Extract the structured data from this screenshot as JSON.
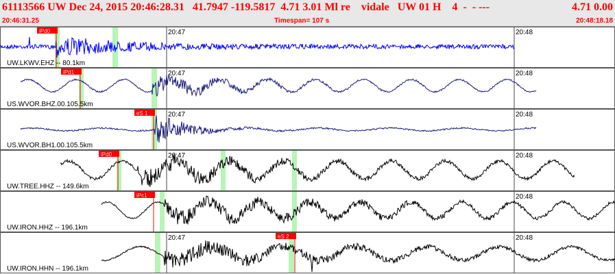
{
  "header": {
    "title": "61113566 UW Dec 24, 2015 20:46:28.31   41.7947 -119.5817  4.71 3.01 Ml re    vidale   UW 01 H    4  -  - ---",
    "title_right": "4.71 0.00",
    "start_time": "20:46:31.25",
    "timespan": "Timespan= 107 s",
    "end_time": "20:48:18.18"
  },
  "colors": {
    "title_text": "#ff0000",
    "bar_bg": "#e8e8e8",
    "pick_box": "#ff0000",
    "pick_highlight": "#b6f5b6",
    "trace_blue": "#0000ff",
    "trace_navy": "#1a1a7a",
    "trace_black": "#000000"
  },
  "panels": [
    {
      "label": "UW.LKWV.EHZ -- 80.1km",
      "minute_labels": [
        "20:47",
        "20:48"
      ],
      "pick": "iPd0",
      "trace_color": "#0000ff"
    },
    {
      "label": "US.WVOR.BHZ.00.105.5km",
      "minute_labels": [
        "20:47",
        "20:48"
      ],
      "pick": "iPd1",
      "trace_color": "#1a1a7a"
    },
    {
      "label": "US.WVOR.BH1.00.105.5km",
      "minute_labels": [
        "20:47",
        "20:48"
      ],
      "pick": "eS 1",
      "trace_color": "#1a1a7a"
    },
    {
      "label": "UW.TREE.HHZ -- 149.6km",
      "minute_labels": [
        "20:47",
        "20:48"
      ],
      "pick": "iPd0",
      "trace_color": "#000000"
    },
    {
      "label": "UW.IRON.HHZ -- 196.1km",
      "minute_labels": [
        "20:48"
      ],
      "pick": "iPc1",
      "trace_color": "#000000"
    },
    {
      "label": "UW.IRON.HHN -- 196.1km",
      "minute_labels": [
        "20:47",
        "20:48"
      ],
      "pick": "eS 2",
      "trace_color": "#000000"
    }
  ]
}
